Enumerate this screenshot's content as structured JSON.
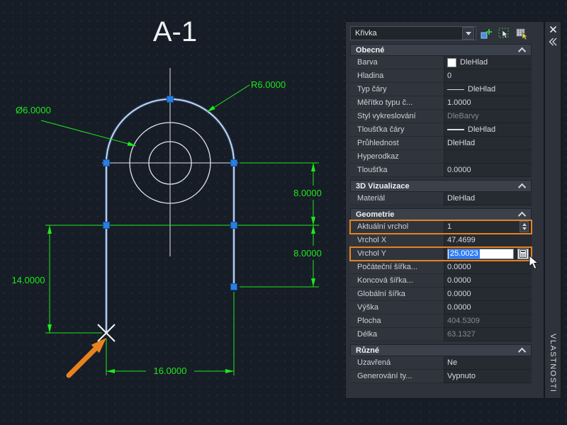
{
  "colors": {
    "dim-green": "#1ce81c",
    "grip-blue": "#2a7de1",
    "hl-orange": "#e8821e",
    "select-blue": "#2f7df6"
  },
  "drawing": {
    "title": "A-1",
    "dims": {
      "radius": "R6.0000",
      "diameter": "Ø6.0000",
      "right_upper": "8.0000",
      "right_lower": "8.0000",
      "left": "14.0000",
      "bottom": "16.0000"
    }
  },
  "palette": {
    "selector": "Křivka",
    "tab_title": "VLASTNOSTI",
    "sections": [
      {
        "title": "Obecné",
        "rows": [
          {
            "label": "Barva",
            "value": "DleHlad"
          },
          {
            "label": "Hladina",
            "value": "0"
          },
          {
            "label": "Typ čáry",
            "value": "DleHlad"
          },
          {
            "label": "Měřítko typu č...",
            "value": "1.0000"
          },
          {
            "label": "Styl vykreslování",
            "value": "DleBarvy"
          },
          {
            "label": "Tloušťka čáry",
            "value": "DleHlad"
          },
          {
            "label": "Průhlednost",
            "value": "DleHlad"
          },
          {
            "label": "Hyperodkaz",
            "value": ""
          },
          {
            "label": "Tloušťka",
            "value": "0.0000"
          }
        ]
      },
      {
        "title": "3D Vizualizace",
        "rows": [
          {
            "label": "Materiál",
            "value": "DleHlad"
          }
        ]
      },
      {
        "title": "Geometrie",
        "rows": [
          {
            "label": "Aktuální vrchol",
            "value": "1"
          },
          {
            "label": "Vrchol X",
            "value": "47.4699"
          },
          {
            "label": "Vrchol Y",
            "value": "25.0023"
          },
          {
            "label": "Počáteční šířka...",
            "value": "0.0000"
          },
          {
            "label": "Koncová šířka...",
            "value": "0.0000"
          },
          {
            "label": "Globální šířka",
            "value": "0.0000"
          },
          {
            "label": "Výška",
            "value": "0.0000"
          },
          {
            "label": "Plocha",
            "value": "404.5309"
          },
          {
            "label": "Délka",
            "value": "63.1327"
          }
        ]
      },
      {
        "title": "Různé",
        "rows": [
          {
            "label": "Uzavřená",
            "value": "Ne"
          },
          {
            "label": "Generování ty...",
            "value": "Vypnuto"
          }
        ]
      }
    ]
  }
}
